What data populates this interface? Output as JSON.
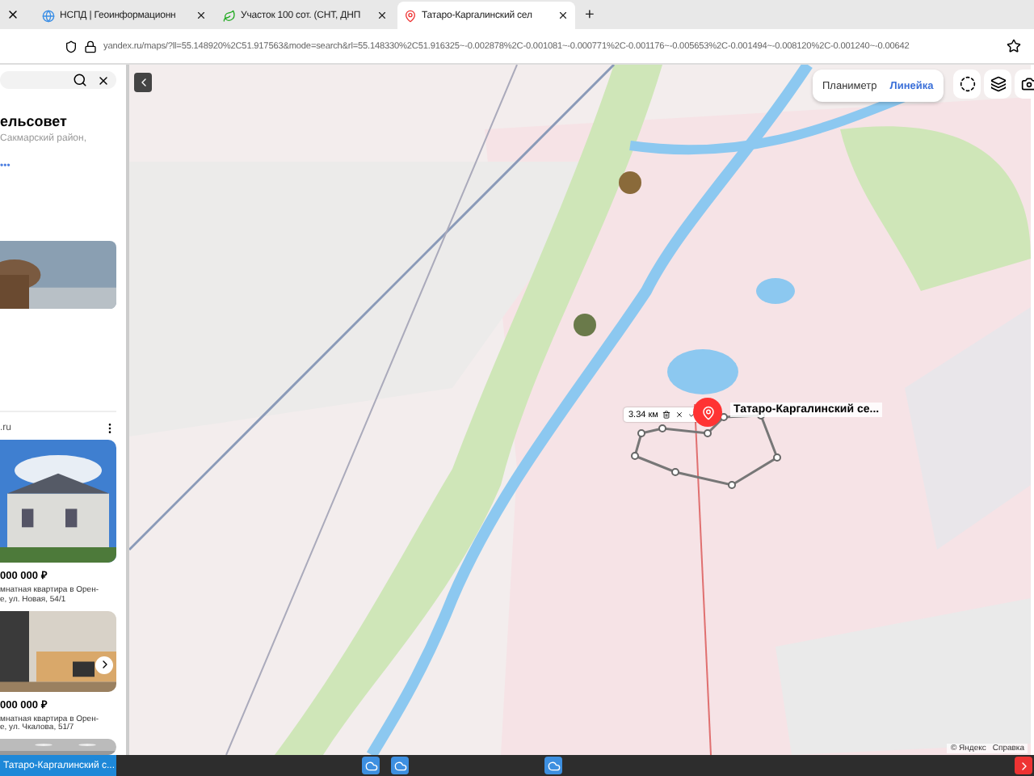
{
  "browser": {
    "tabs": [
      {
        "title": "НСПД | Геоинформационн",
        "selected": false
      },
      {
        "title": "Участок 100 сот. (СНТ, ДНП",
        "selected": false
      },
      {
        "title": "Татаро-Каргалинский сел",
        "selected": true
      }
    ],
    "new_tab": "+",
    "url": "yandex.ru/maps/?ll=55.148920%2C51.917563&mode=search&rl=55.148330%2C51.916325~-0.002878%2C-0.001081~-0.000771%2C-0.001176~-0.005653%2C-0.001494~-0.008120%2C-0.001240~-0.00642"
  },
  "sidebar": {
    "title": "ельсовет",
    "subtitle": "Сакмарский район,",
    "more": "•••",
    "source": ".ru",
    "listings": [
      {
        "price": "000 000 ₽",
        "description": "мнатная квартира в Орен-",
        "address": "е, ул. Новая, 54/1"
      },
      {
        "price": "000 000 ₽",
        "description": "мнатная квартира в Орен-",
        "address": "е, ул. Чкалова, 51/7"
      }
    ]
  },
  "map": {
    "modes": [
      {
        "label": "Планиметр",
        "selected": false
      },
      {
        "label": "Линейка",
        "selected": true
      }
    ],
    "ruler": {
      "distance": "3.34 км"
    },
    "place_label": "Татаро-Каргалинский се...",
    "copyright": "© Яндекс",
    "help_link": "Справка"
  },
  "taskbar": {
    "active_window": "Татаро-Каргалинский с..."
  }
}
